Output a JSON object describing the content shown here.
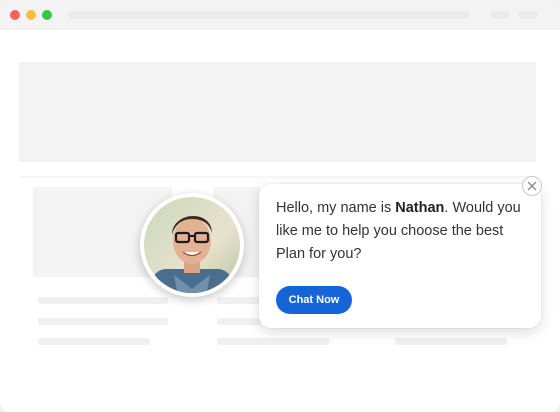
{
  "chat_popup": {
    "message_prefix": "Hello, my name is ",
    "agent_name": "Nathan",
    "message_suffix": ". Would you like me to help you choose the best Plan for you?",
    "button_label": "Chat Now",
    "close_icon": "close-icon"
  },
  "avatar": {
    "description_icon": "agent-avatar"
  },
  "colors": {
    "accent": "#1565d8",
    "window_dot_red": "#fc6058",
    "window_dot_yellow": "#fdbc40",
    "window_dot_green": "#34c84a"
  }
}
